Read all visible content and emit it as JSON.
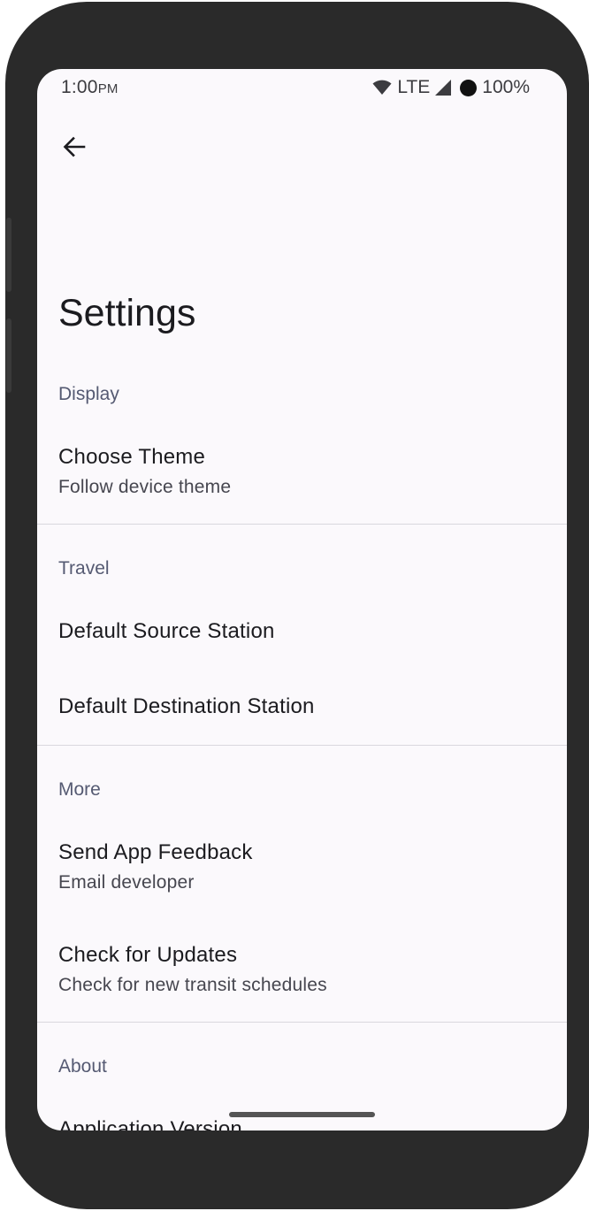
{
  "status_bar": {
    "time": "1:00",
    "ampm": "PM",
    "network": "LTE",
    "battery": "100%"
  },
  "icons": {
    "back": "arrow-back-icon",
    "wifi": "wifi-icon",
    "signal": "cell-signal-icon",
    "battery": "battery-icon"
  },
  "page": {
    "title": "Settings"
  },
  "sections": {
    "display": {
      "header": "Display",
      "choose_theme": {
        "title": "Choose Theme",
        "summary": "Follow device theme"
      }
    },
    "travel": {
      "header": "Travel",
      "default_source": {
        "title": "Default Source Station"
      },
      "default_destination": {
        "title": "Default Destination Station"
      }
    },
    "more": {
      "header": "More",
      "send_feedback": {
        "title": "Send App Feedback",
        "summary": "Email developer"
      },
      "check_updates": {
        "title": "Check for Updates",
        "summary": "Check for new transit schedules"
      }
    },
    "about": {
      "header": "About",
      "app_version": {
        "title": "Application Version"
      }
    }
  }
}
